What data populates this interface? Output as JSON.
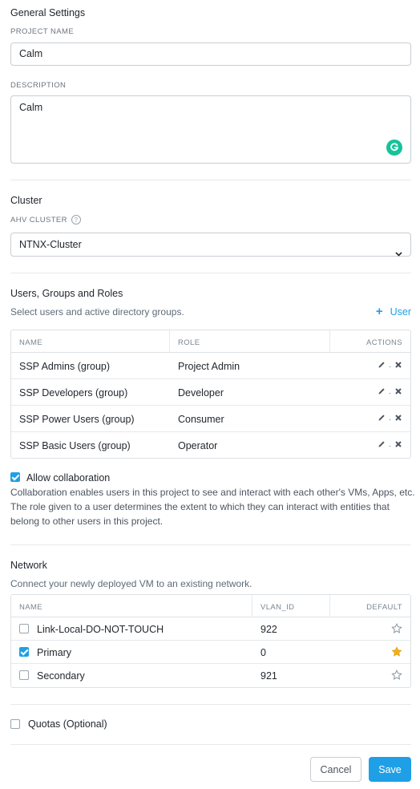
{
  "general": {
    "title": "General Settings",
    "project_name_label": "PROJECT NAME",
    "project_name_value": "Calm",
    "description_label": "DESCRIPTION",
    "description_value": "Calm"
  },
  "cluster": {
    "title": "Cluster",
    "ahv_label": "AHV CLUSTER",
    "selected": "NTNX-Cluster"
  },
  "users": {
    "title": "Users, Groups and Roles",
    "subtitle": "Select users and active directory groups.",
    "add_label": "User",
    "columns": [
      "NAME",
      "ROLE",
      "ACTIONS"
    ],
    "rows": [
      {
        "name": "SSP Admins (group)",
        "role": "Project Admin"
      },
      {
        "name": "SSP Developers (group)",
        "role": "Developer"
      },
      {
        "name": "SSP Power Users (group)",
        "role": "Consumer"
      },
      {
        "name": "SSP Basic Users (group)",
        "role": "Operator"
      }
    ]
  },
  "collaboration": {
    "label": "Allow collaboration",
    "checked": true,
    "description": "Collaboration enables users in this project to see and interact with each other's VMs, Apps, etc. The role given to a user determines the extent to which they can interact with entities that belong to other users in this project."
  },
  "network": {
    "title": "Network",
    "subtitle": "Connect your newly deployed VM to an existing network.",
    "columns": [
      "NAME",
      "VLAN_ID",
      "DEFAULT"
    ],
    "rows": [
      {
        "name": "Link-Local-DO-NOT-TOUCH",
        "vlan": "922",
        "checked": false,
        "default": false
      },
      {
        "name": "Primary",
        "vlan": "0",
        "checked": true,
        "default": true
      },
      {
        "name": "Secondary",
        "vlan": "921",
        "checked": false,
        "default": false
      }
    ]
  },
  "quotas": {
    "label": "Quotas (Optional)",
    "checked": false
  },
  "footer": {
    "cancel_label": "Cancel",
    "save_label": "Save"
  },
  "colors": {
    "accent": "#1fa0e6",
    "star_filled": "#f2b01e",
    "grammarly": "#15c39a"
  }
}
